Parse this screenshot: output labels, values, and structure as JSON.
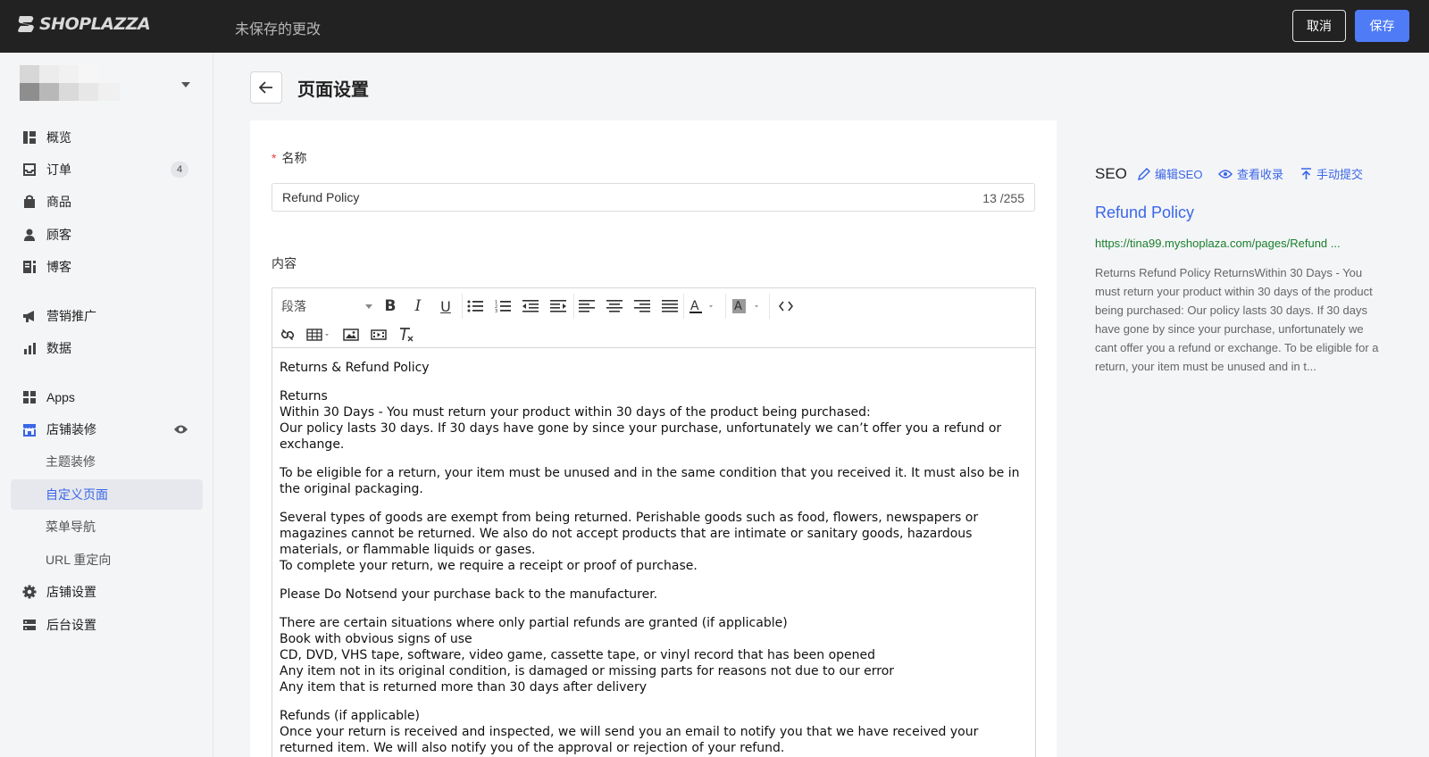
{
  "topbar": {
    "logo": "SHOPLAZZA",
    "unsaved_text": "未保存的更改",
    "cancel_label": "取消",
    "save_label": "保存"
  },
  "sidebar": {
    "items": [
      {
        "label": "概览",
        "icon": "dashboard-icon"
      },
      {
        "label": "订单",
        "icon": "inbox-icon",
        "badge": "4"
      },
      {
        "label": "商品",
        "icon": "bag-icon"
      },
      {
        "label": "顾客",
        "icon": "person-icon"
      },
      {
        "label": "博客",
        "icon": "blog-icon"
      },
      {
        "label": "营销推广",
        "icon": "megaphone-icon"
      },
      {
        "label": "数据",
        "icon": "bar-chart-icon"
      },
      {
        "label": "Apps",
        "icon": "apps-icon"
      },
      {
        "label": "店铺装修",
        "icon": "store-icon"
      },
      {
        "label": "主题装修"
      },
      {
        "label": "自定义页面"
      },
      {
        "label": "菜单导航"
      },
      {
        "label": "URL 重定向"
      },
      {
        "label": "店铺设置",
        "icon": "gear-icon"
      },
      {
        "label": "后台设置",
        "icon": "server-icon"
      }
    ]
  },
  "page": {
    "title": "页面设置",
    "name_label": "名称",
    "name_value": "Refund Policy",
    "name_count": "13 /255",
    "content_label": "内容"
  },
  "editor": {
    "paragraph_select": "段落",
    "body": [
      "Returns & Refund Policy",
      "Returns\nWithin 30 Days - You must return your product within 30 days of the product being purchased:\nOur policy lasts 30 days. If 30 days have gone by since your purchase, unfortunately we can’t offer you a refund or exchange.",
      "To be eligible for a return, your item must be unused and in the same condition that you received it. It must also be in the original packaging.",
      "Several types of goods are exempt from being returned. Perishable goods such as food, flowers, newspapers or magazines cannot be returned. We also do not accept products that are intimate or sanitary goods, hazardous materials, or flammable liquids or gases.\nTo complete your return, we require a receipt or proof of purchase.",
      "Please Do Notsend your purchase back to the manufacturer.",
      "There are certain situations where only partial refunds are granted (if applicable)\nBook with obvious signs of use\nCD, DVD, VHS tape, software, video game, cassette tape, or vinyl record that has been opened\nAny item not in its original condition, is damaged or missing parts for reasons not due to our error\nAny item that is returned more than 30 days after delivery",
      "Refunds (if applicable)\nOnce your return is received and inspected, we will send you an email to notify you that we have received your returned item. We will also notify you of the approval or rejection of your refund."
    ]
  },
  "seo": {
    "label": "SEO",
    "edit_label": "编辑SEO",
    "view_label": "查看收录",
    "submit_label": "手动提交",
    "title": "Refund Policy",
    "url": "https://tina99.myshoplaza.com/pages/Refund ...",
    "description": "Returns Refund Policy ReturnsWithin 30 Days - You must return your product within 30 days of the product being purchased: Our policy lasts 30 days. If 30 days have gone by since your purchase, unfortunately we cant offer you a refund or exchange. To be eligible for a return, your item must be unused and in t..."
  },
  "colors": {
    "accent": "#4f7cf6",
    "link": "#3a66e8",
    "url_green": "#1a7f2c",
    "topbar": "#222223"
  }
}
